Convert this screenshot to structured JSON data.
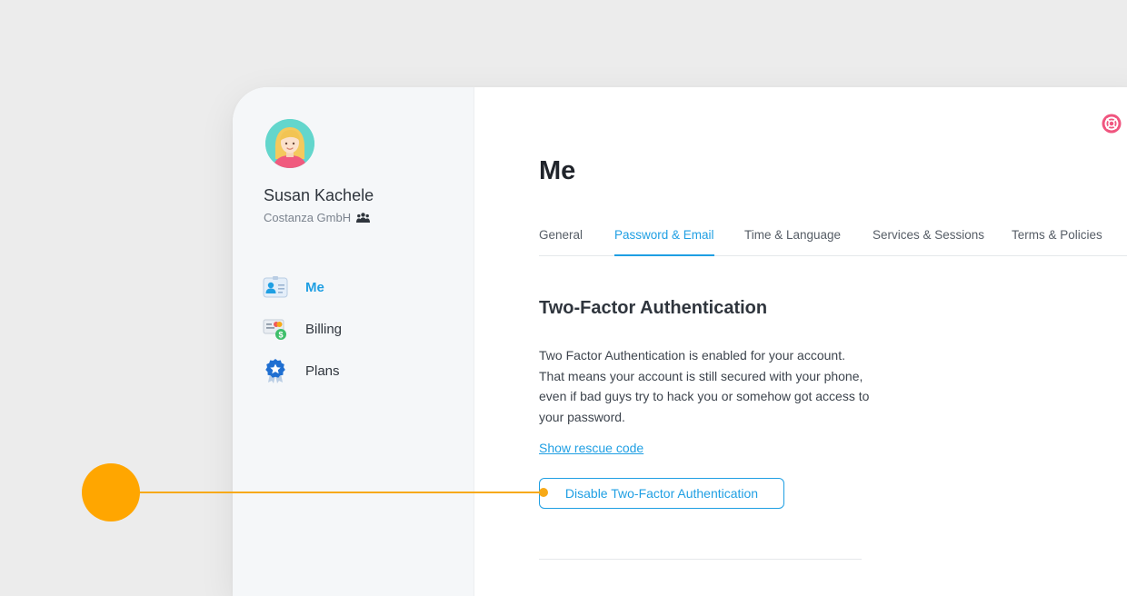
{
  "user": {
    "name": "Susan Kachele",
    "company": "Costanza GmbH"
  },
  "sidebar": {
    "items": [
      {
        "label": "Me",
        "icon": "id-card-icon",
        "active": true
      },
      {
        "label": "Billing",
        "icon": "billing-icon",
        "active": false
      },
      {
        "label": "Plans",
        "icon": "plan-badge-icon",
        "active": false
      }
    ]
  },
  "main": {
    "title": "Me",
    "tabs": [
      {
        "label": "General",
        "active": false
      },
      {
        "label": "Password & Email",
        "active": true
      },
      {
        "label": "Time & Language",
        "active": false
      },
      {
        "label": "Services & Sessions",
        "active": false
      },
      {
        "label": "Terms & Policies",
        "active": false
      }
    ],
    "section": {
      "title": "Two-Factor Authentication",
      "body": "Two Factor Authentication is enabled for your account. That means your account is still secured with your phone, even if bad guys try to hack you or somehow got access to your password.",
      "rescue_link": "Show rescue code",
      "disable_button": "Disable Two-Factor Authentication"
    }
  },
  "colors": {
    "accent": "#1f9fe3",
    "callout": "#ffa600",
    "help": "#f0557f",
    "avatar_bg": "#63d6cc"
  }
}
